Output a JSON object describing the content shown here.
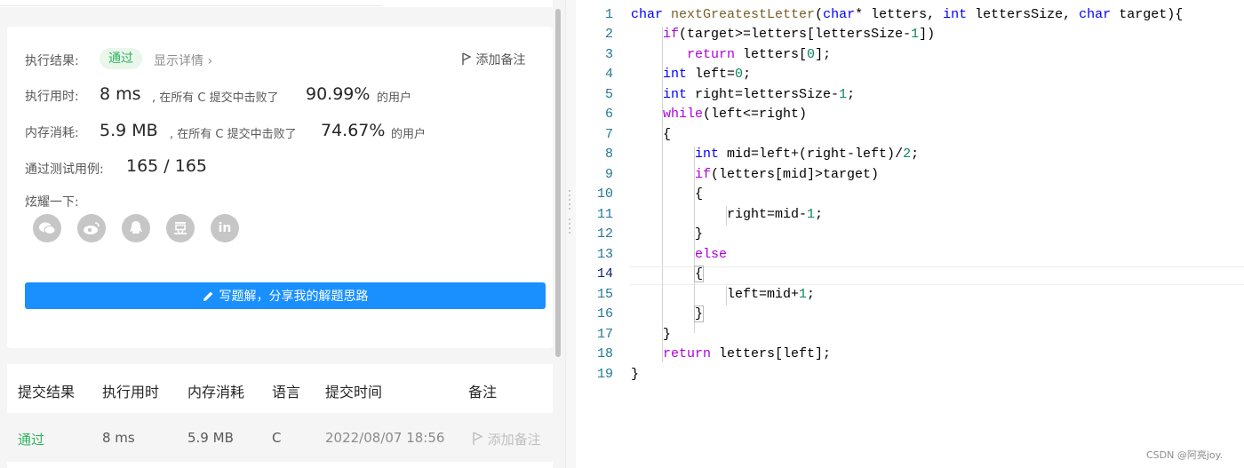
{
  "result": {
    "exec_result_label": "执行结果:",
    "status_badge": "通过",
    "details_link": "显示详情 ›",
    "add_note": "添加备注",
    "time_label": "执行用时:",
    "time_value": "8 ms",
    "time_beat_prefix": ", 在所有 C 提交中击败了",
    "time_percent": "90.99%",
    "users_suffix": "的用户",
    "memory_label": "内存消耗:",
    "memory_value": "5.9 MB",
    "memory_beat_prefix": ", 在所有 C 提交中击败了",
    "memory_percent": "74.67%",
    "tests_label": "通过测试用例:",
    "tests_value": "165 / 165",
    "share_label": "炫耀一下:",
    "share_icons": [
      "wechat-icon",
      "weibo-icon",
      "qq-icon",
      "douban-icon",
      "linkedin-icon"
    ],
    "share_icon_glyphs": [
      "●",
      "◉",
      "▲",
      "豆",
      "in"
    ],
    "write_solution_button": "写题解，分享我的解题思路"
  },
  "submissions": {
    "headers": [
      "提交结果",
      "执行用时",
      "内存消耗",
      "语言",
      "提交时间",
      "备注"
    ],
    "rows": [
      {
        "result": "通过",
        "time": "8 ms",
        "memory": "5.9 MB",
        "language": "C",
        "submitted": "2022/08/07 18:56",
        "note": "添加备注"
      }
    ]
  },
  "editor": {
    "line_numbers": [
      "1",
      "2",
      "3",
      "4",
      "5",
      "6",
      "7",
      "8",
      "9",
      "10",
      "11",
      "12",
      "13",
      "14",
      "15",
      "16",
      "17",
      "18",
      "19"
    ],
    "active_line": "14"
  },
  "watermark": "CSDN @阿亮joy.",
  "colors": {
    "accent_blue": "#1a90ff",
    "success_green": "#2db55d",
    "keyword_blue": "#0000ff",
    "control_purple": "#af00db",
    "number_green": "#098658",
    "function_brown": "#795e26"
  }
}
